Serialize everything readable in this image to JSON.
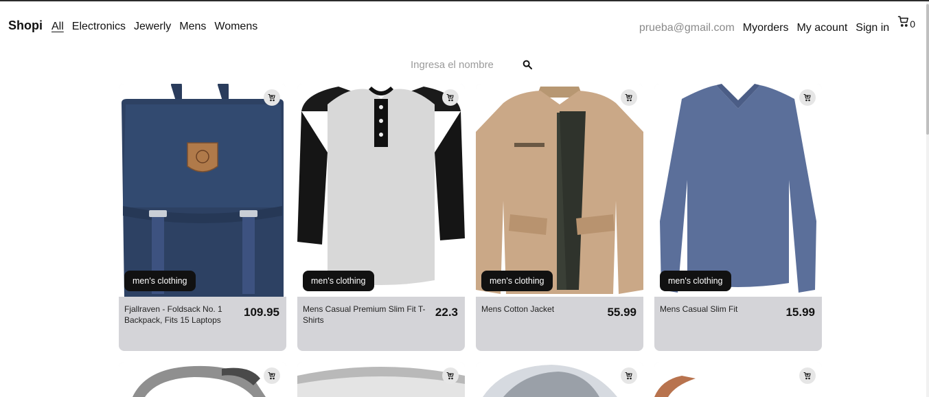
{
  "nav": {
    "brand": "Shopi",
    "categories": [
      "All",
      "Electronics",
      "Jewerly",
      "Mens",
      "Womens"
    ],
    "email": "prueba@gmail.com",
    "myorders": "Myorders",
    "myaccount": "My acount",
    "signin": "Sign in",
    "cart_count": "0"
  },
  "search": {
    "placeholder": "Ingresa el nombre"
  },
  "products": [
    {
      "title": "Fjallraven - Foldsack No. 1 Backpack, Fits 15 Laptops",
      "price": "109.95",
      "category": "men's clothing"
    },
    {
      "title": "Mens Casual Premium Slim Fit T-Shirts",
      "price": "22.3",
      "category": "men's clothing"
    },
    {
      "title": "Mens Cotton Jacket",
      "price": "55.99",
      "category": "men's clothing"
    },
    {
      "title": "Mens Casual Slim Fit",
      "price": "15.99",
      "category": "men's clothing"
    }
  ],
  "colors": {
    "card_bg": "#d4d4d8",
    "badge_bg": "#111111",
    "email_gray": "#8a8a8a"
  }
}
